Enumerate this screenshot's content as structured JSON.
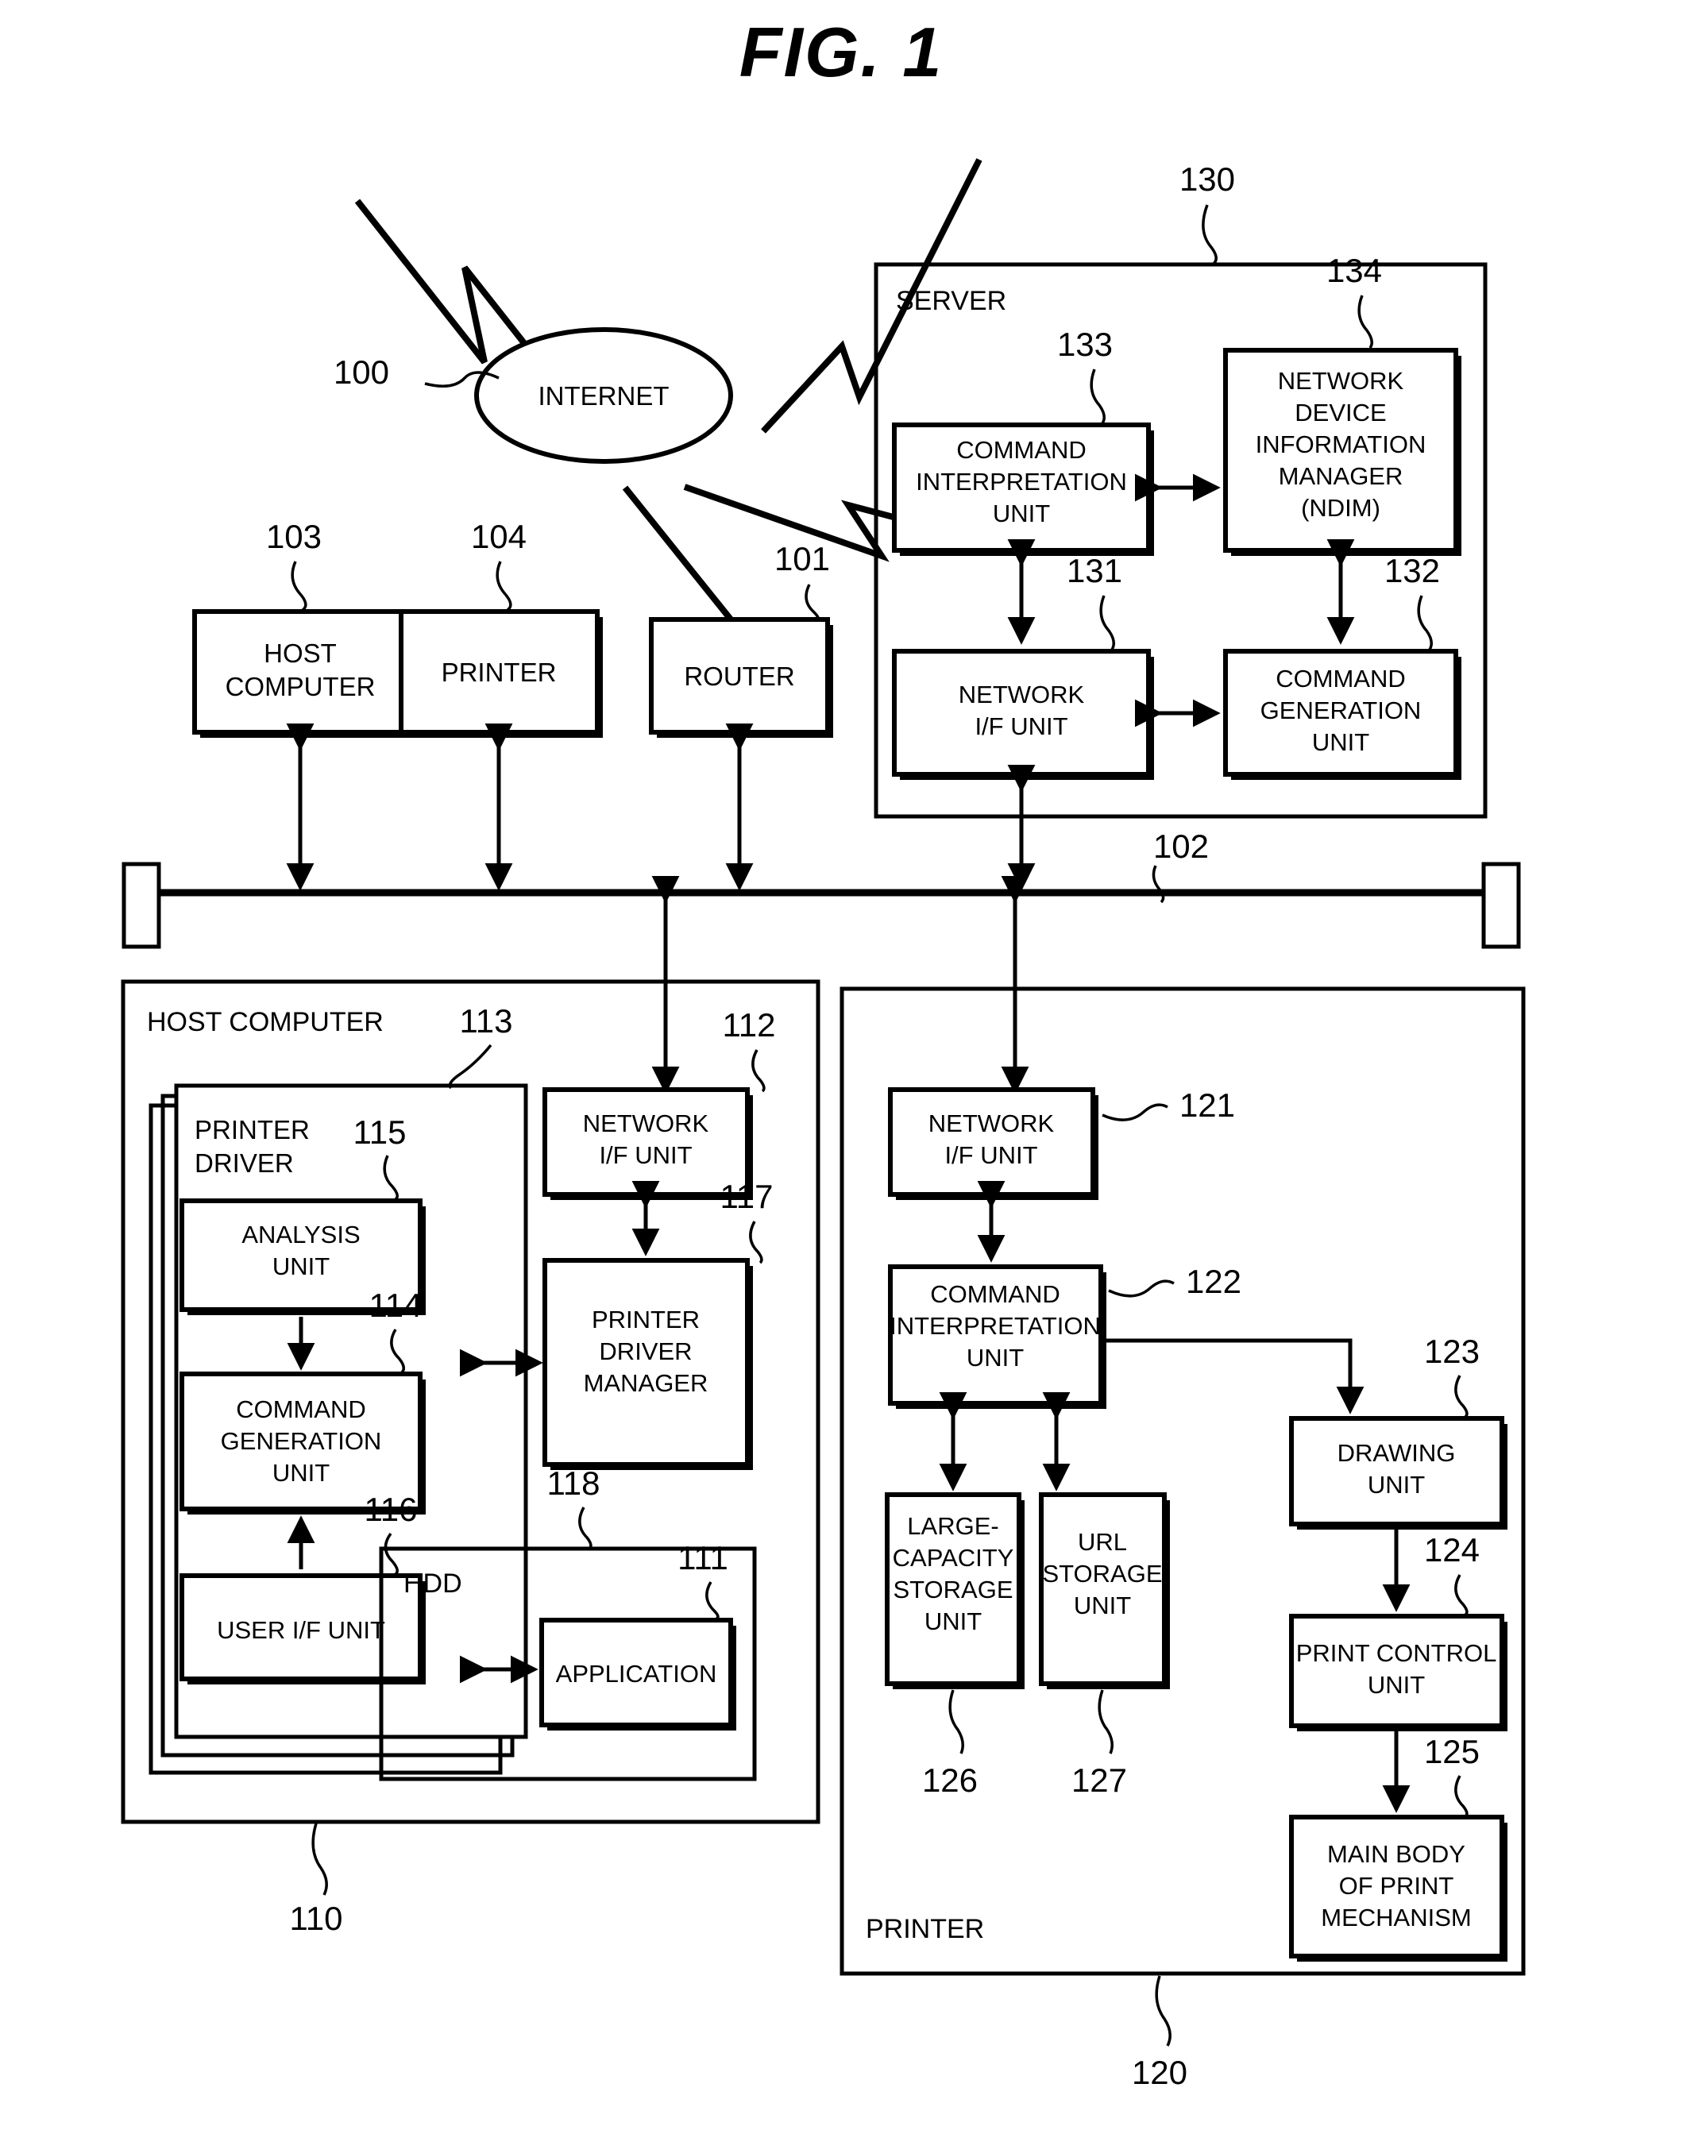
{
  "figure": {
    "title": "FIG. 1",
    "domain_note": "patent system block diagram"
  },
  "network": {
    "internet": {
      "label": "INTERNET",
      "ref": "100"
    },
    "bus": {
      "ref": "102"
    }
  },
  "top_devices": [
    {
      "label": "HOST COMPUTER",
      "ref": "103"
    },
    {
      "label": "PRINTER",
      "ref": "104"
    },
    {
      "label": "ROUTER",
      "ref": "101"
    }
  ],
  "server": {
    "title": "SERVER",
    "ref": "130",
    "blocks": [
      {
        "label": "COMMAND INTERPRETATION UNIT",
        "ref": "133"
      },
      {
        "label": "NETWORK DEVICE INFORMATION MANAGER (NDIM)",
        "ref": "134"
      },
      {
        "label": "NETWORK I/F UNIT",
        "ref": "131"
      },
      {
        "label": "COMMAND GENERATION UNIT",
        "ref": "132"
      }
    ]
  },
  "host_computer": {
    "title": "HOST COMPUTER",
    "ref": "110",
    "printer_driver": {
      "label": "PRINTER DRIVER",
      "ref": "113"
    },
    "hdd": {
      "label": "HDD",
      "ref": "118"
    },
    "blocks": [
      {
        "label": "ANALYSIS UNIT",
        "ref": "115"
      },
      {
        "label": "COMMAND GENERATION UNIT",
        "ref": "114"
      },
      {
        "label": "USER I/F UNIT",
        "ref": "116"
      },
      {
        "label": "NETWORK I/F UNIT",
        "ref": "112"
      },
      {
        "label": "PRINTER DRIVER MANAGER",
        "ref": "117"
      },
      {
        "label": "APPLICATION",
        "ref": "111"
      }
    ]
  },
  "printer": {
    "title": "PRINTER",
    "ref": "120",
    "blocks": [
      {
        "label": "NETWORK I/F UNIT",
        "ref": "121"
      },
      {
        "label": "COMMAND INTERPRETATION UNIT",
        "ref": "122"
      },
      {
        "label": "DRAWING UNIT",
        "ref": "123"
      },
      {
        "label": "PRINT CONTROL UNIT",
        "ref": "124"
      },
      {
        "label": "MAIN BODY OF PRINT MECHANISM",
        "ref": "125"
      },
      {
        "label": "LARGE-CAPACITY STORAGE UNIT",
        "ref": "126"
      },
      {
        "label": "URL STORAGE UNIT",
        "ref": "127"
      }
    ]
  },
  "text": {
    "t_fig": "FIG. 1",
    "t_internet": "INTERNET",
    "t_host_computer": "HOST COMPUTER",
    "t_printer": "PRINTER",
    "t_router": "ROUTER",
    "t_server": "SERVER",
    "t_cmd_interp_1": "COMMAND",
    "t_cmd_interp_2": "INTERPRETATION",
    "t_cmd_interp_3": "UNIT",
    "t_ndim_1": "NETWORK",
    "t_ndim_2": "DEVICE",
    "t_ndim_3": "INFORMATION",
    "t_ndim_4": "MANAGER",
    "t_ndim_5": "(NDIM)",
    "t_net_if_1": "NETWORK",
    "t_net_if_2": "I/F UNIT",
    "t_cmd_gen_1": "COMMAND",
    "t_cmd_gen_2": "GENERATION",
    "t_cmd_gen_3": "UNIT",
    "t_printer_driver_1": "PRINTER",
    "t_printer_driver_2": "DRIVER",
    "t_analysis_1": "ANALYSIS",
    "t_analysis_2": "UNIT",
    "t_user_if": "USER I/F UNIT",
    "t_pdm_1": "PRINTER",
    "t_pdm_2": "DRIVER",
    "t_pdm_3": "MANAGER",
    "t_hdd": "HDD",
    "t_application": "APPLICATION",
    "t_drawing_1": "DRAWING",
    "t_drawing_2": "UNIT",
    "t_print_ctrl_1": "PRINT CONTROL",
    "t_print_ctrl_2": "UNIT",
    "t_main_body_1": "MAIN BODY",
    "t_main_body_2": "OF PRINT",
    "t_main_body_3": "MECHANISM",
    "t_lcsu_1": "LARGE-",
    "t_lcsu_2": "CAPACITY",
    "t_lcsu_3": "STORAGE",
    "t_lcsu_4": "UNIT",
    "t_url_1": "URL",
    "t_url_2": "STORAGE",
    "t_url_3": "UNIT",
    "n100": "100",
    "n101": "101",
    "n102": "102",
    "n103": "103",
    "n104": "104",
    "n110": "110",
    "n111": "111",
    "n112": "112",
    "n113": "113",
    "n114": "114",
    "n115": "115",
    "n116": "116",
    "n117": "117",
    "n118": "118",
    "n120": "120",
    "n121": "121",
    "n122": "122",
    "n123": "123",
    "n124": "124",
    "n125": "125",
    "n126": "126",
    "n127": "127",
    "n130": "130",
    "n131": "131",
    "n132": "132",
    "n133": "133",
    "n134": "134"
  },
  "colors": {
    "ink": "#000000",
    "paper": "#ffffff"
  }
}
